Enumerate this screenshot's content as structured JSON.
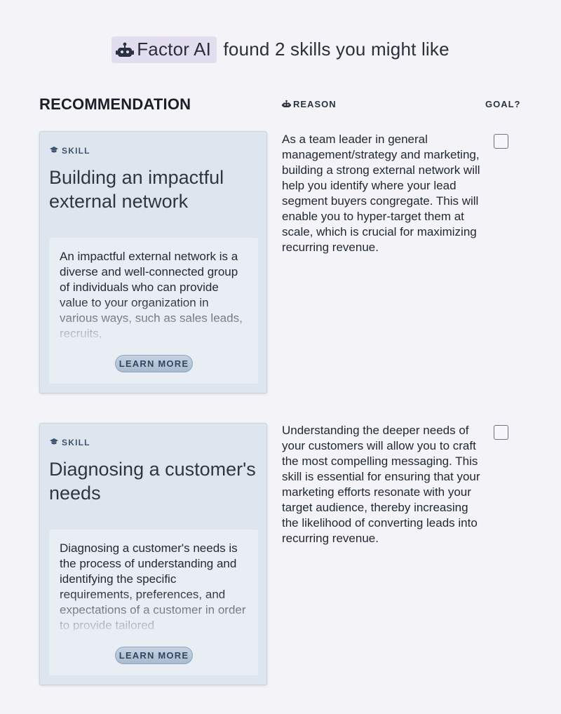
{
  "header": {
    "brand": "Factor AI",
    "message": "found 2 skills you might like",
    "brand_icon": "robot-icon"
  },
  "columns": {
    "recommendation": "RECOMMENDATION",
    "reason": "REASON",
    "goal": "GOAL?"
  },
  "skills": [
    {
      "tag": "SKILL",
      "title": "Building an impactful external network",
      "description": "An impactful external network is a diverse and well-connected group of individuals who can provide value to your organization in various ways, such as sales leads, recruits,",
      "learn_more": "LEARN MORE",
      "reason": "As a team leader in general management/strategy and marketing, building a strong external network will help you identify where your lead segment buyers congregate. This will enable you to hyper-target them at scale, which is crucial for maximizing recurring revenue.",
      "goal_checked": false
    },
    {
      "tag": "SKILL",
      "title": "Diagnosing a customer's needs",
      "description": "Diagnosing a customer's needs is the process of understanding and identifying the specific requirements, preferences, and expectations of a customer in order to provide tailored",
      "learn_more": "LEARN MORE",
      "reason": "Understanding the deeper needs of your customers will allow you to craft the most compelling messaging. This skill is essential for ensuring that your marketing efforts resonate with your target audience, thereby increasing the likelihood of converting leads into recurring revenue.",
      "goal_checked": false
    }
  ],
  "colors": {
    "background": "#f3f3f8",
    "card": "#dde6ee",
    "badge": "#e2def0",
    "accent": "#3d5470"
  }
}
